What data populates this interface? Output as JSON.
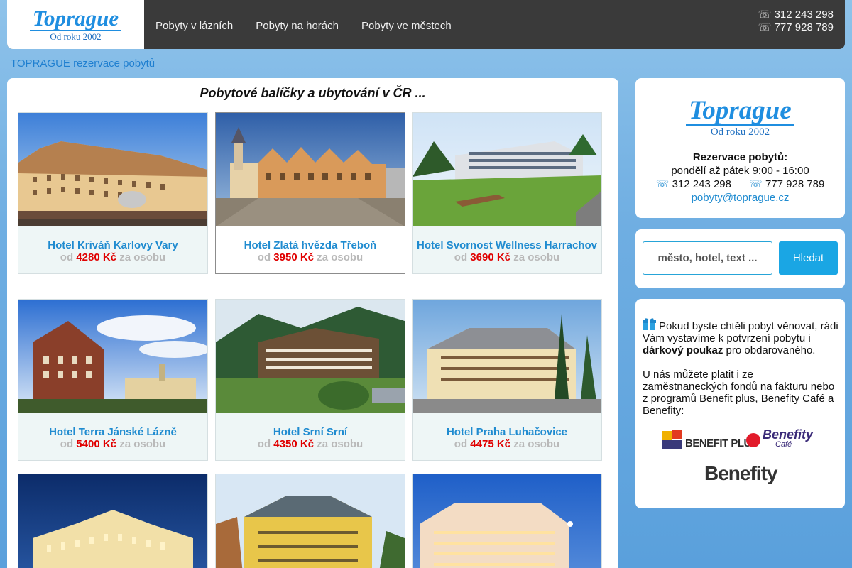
{
  "header": {
    "logo_title": "Toprague",
    "logo_subtitle": "Od roku 2002",
    "nav": [
      "Pobyty v lázních",
      "Pobyty na horách",
      "Pobyty ve městech"
    ],
    "phones": [
      "312 243 298",
      "777 928 789"
    ],
    "phone_icon": "☏"
  },
  "breadcrumb": "TOPRAGUE rezervace pobytů",
  "main": {
    "title": "Pobytové balíčky a ubytování v ČR ...",
    "price_prefix": "od",
    "price_suffix": "za osobu",
    "hotels": [
      {
        "name": "Hotel Kriváň Karlovy Vary",
        "price": "4280 Kč",
        "image": "hotel-krivan-photo"
      },
      {
        "name": "Hotel Zlatá hvězda Třeboň",
        "price": "3950 Kč",
        "image": "hotel-zlata-hvezda-photo"
      },
      {
        "name": "Hotel Svornost Wellness Harrachov",
        "price": "3690 Kč",
        "image": "hotel-svornost-photo"
      },
      {
        "name": "Hotel Terra Jánské Lázně",
        "price": "5400 Kč",
        "image": "hotel-terra-photo"
      },
      {
        "name": "Hotel Srní Srní",
        "price": "4350 Kč",
        "image": "hotel-srni-photo"
      },
      {
        "name": "Hotel Praha Luhačovice",
        "price": "4475 Kč",
        "image": "hotel-praha-photo"
      },
      {
        "name": "",
        "price": "",
        "image": "hotel-night-palace-photo"
      },
      {
        "name": "",
        "price": "",
        "image": "hotel-yellow-spa-photo"
      },
      {
        "name": "",
        "price": "",
        "image": "hotel-evening-spa-photo"
      }
    ]
  },
  "sidebar": {
    "logo_title": "Toprague",
    "logo_subtitle": "Od roku 2002",
    "contact_label": "Rezervace pobytů:",
    "hours": "pondělí až pátek 9:00 - 16:00",
    "phones": [
      "312 243 298",
      "777 928 789"
    ],
    "email": "pobyty@toprague.cz",
    "search_placeholder": "město, hotel, text ...",
    "search_button": "Hledat",
    "gift_text_1": "Pokud byste chtěli pobyt věnovat, rádi Vám vystavíme k potvrzení pobytu i",
    "gift_bold": "dárkový poukaz",
    "gift_text_2": "pro obdarovaného.",
    "benefit_text": "U nás můžete platit i ze zaměstnaneckých fondů na fakturu nebo z programů Benefit plus, Benefity Café a Benefity:",
    "logo_benefit_plus": "BENEFIT PLUS",
    "logo_benefity_cafe": "Benefity",
    "logo_benefity_cafe_sub": "Café",
    "logo_benefity": "Benefity"
  }
}
